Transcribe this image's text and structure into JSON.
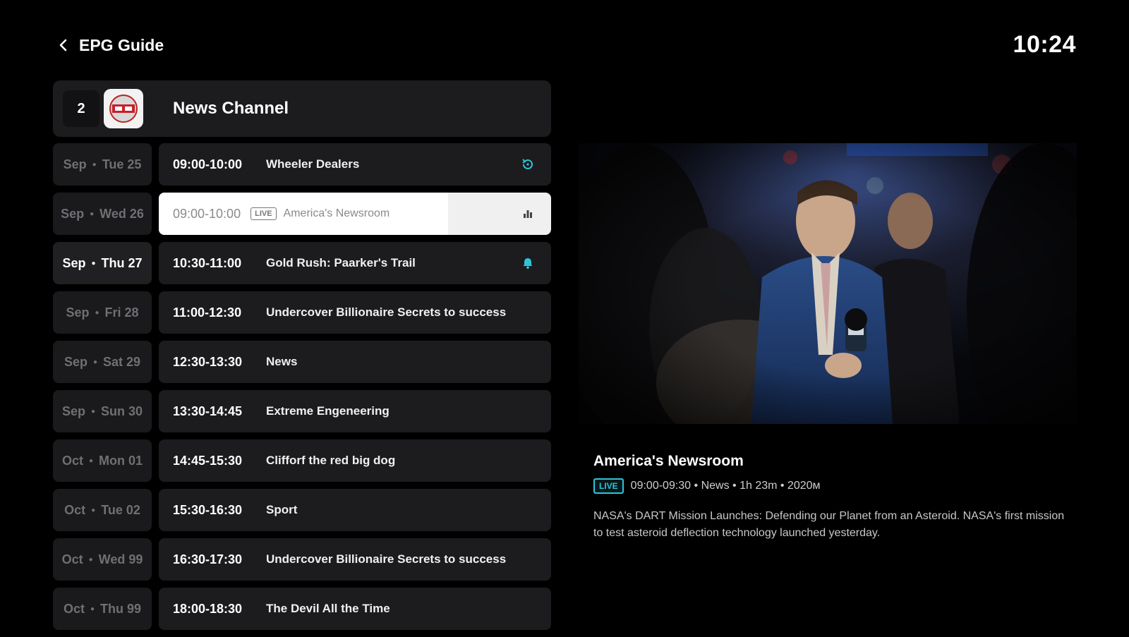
{
  "header": {
    "title": "EPG Guide",
    "clock": "10:24"
  },
  "channel": {
    "number": "2",
    "name": "News Channel"
  },
  "colors": {
    "accent": "#2ec4d6",
    "background": "#000000",
    "card": "#1c1c1e"
  },
  "rows": [
    {
      "month": "Sep",
      "day": "Tue 25",
      "time": "09:00-10:00",
      "title": "Wheeler Dealers",
      "icon": "replay-icon"
    },
    {
      "month": "Sep",
      "day": "Wed 26",
      "time": "09:00-10:00",
      "badge": "LIVE",
      "title": "America's Newsroom",
      "icon": "equalizer-icon",
      "selected": true
    },
    {
      "month": "Sep",
      "day": "Thu 27",
      "time": "10:30-11:00",
      "title": "Gold Rush: Paarker's Trail",
      "icon": "bell-icon",
      "active_date": true
    },
    {
      "month": "Sep",
      "day": "Fri 28",
      "time": "11:00-12:30",
      "title": "Undercover Billionaire Secrets to success"
    },
    {
      "month": "Sep",
      "day": "Sat 29",
      "time": "12:30-13:30",
      "title": "News"
    },
    {
      "month": "Sep",
      "day": "Sun 30",
      "time": "13:30-14:45",
      "title": "Extreme Engeneering"
    },
    {
      "month": "Oct",
      "day": "Mon 01",
      "time": "14:45-15:30",
      "title": "Clifforf the red big dog"
    },
    {
      "month": "Oct",
      "day": "Tue 02",
      "time": "15:30-16:30",
      "title": "Sport"
    },
    {
      "month": "Oct",
      "day": "Wed 99",
      "time": "16:30-17:30",
      "title": "Undercover Billionaire Secrets to success"
    },
    {
      "month": "Oct",
      "day": "Thu 99",
      "time": "18:00-18:30",
      "title": "The Devil All the Time"
    }
  ],
  "details": {
    "title": "America's Newsroom",
    "badge": "LIVE",
    "meta": "09:00-09:30 • News • 1h 23m • 2020м",
    "description": "NASA's DART Mission Launches: Defending our Planet from an Asteroid. NASA's first mission to test asteroid deflection technology launched yesterday."
  }
}
